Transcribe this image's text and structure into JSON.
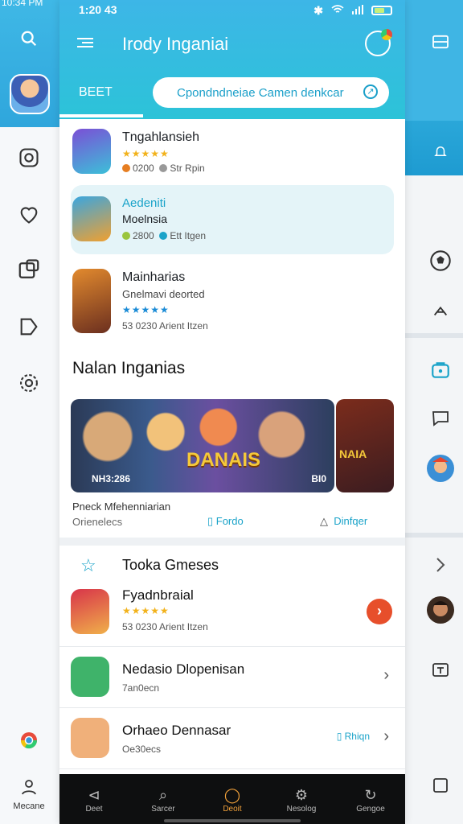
{
  "left_rail": {
    "time": "10:34 PM",
    "bottom_label": "Mecane"
  },
  "status": {
    "time": "1:20 43"
  },
  "header": {
    "title": "Irody Inganiai",
    "tab_label": "BEET",
    "search_text": "Cpondndneiae Camen denkcar"
  },
  "games": [
    {
      "name": "Tngahlansieh",
      "stars": "★★★★★",
      "meta1": "0200",
      "meta2": "Str Rpin"
    },
    {
      "name": "Aedeniti",
      "sub": "Moelnsia",
      "meta1": "2800",
      "meta2": "Ett Itgen"
    },
    {
      "name": "Mainharias",
      "sub": "Gnelmavi deorted",
      "stars": "★★★★★",
      "meta": "53  0230  Arient Itzen"
    }
  ],
  "section_title": "Nalan Inganias",
  "banner": {
    "title": "DANAIS",
    "left": "NH3:286",
    "right": "BI0",
    "side_title": "NAIA",
    "caption1": "Pneck Mfehenniarian",
    "caption2": "Orienelecs",
    "link1": "Fordo",
    "link2": "Dinfqer"
  },
  "top_games": {
    "title": "Tooka Gmeses",
    "rows": [
      {
        "name": "Fyadnbraial",
        "stars": "★★★★★",
        "sub": "53  0230  Arient Itzen"
      },
      {
        "name": "Nedasio Dlopenisan",
        "sub": "7an0ecn"
      },
      {
        "name": "Orhaeo Dennasar",
        "sub": "Oe30ecs",
        "tag": "Rhiqn"
      }
    ]
  },
  "bottom_nav": [
    {
      "label": "Deet",
      "icon": "⊲"
    },
    {
      "label": "Sarcer",
      "icon": "⌕"
    },
    {
      "label": "Deoit",
      "icon": "◯"
    },
    {
      "label": "Nesolog",
      "icon": "⚙"
    },
    {
      "label": "Gengoe",
      "icon": "↻"
    }
  ],
  "colors": {
    "accent": "#1aa3c9",
    "header": "#3db6e7",
    "active_nav": "#f2a13a"
  }
}
